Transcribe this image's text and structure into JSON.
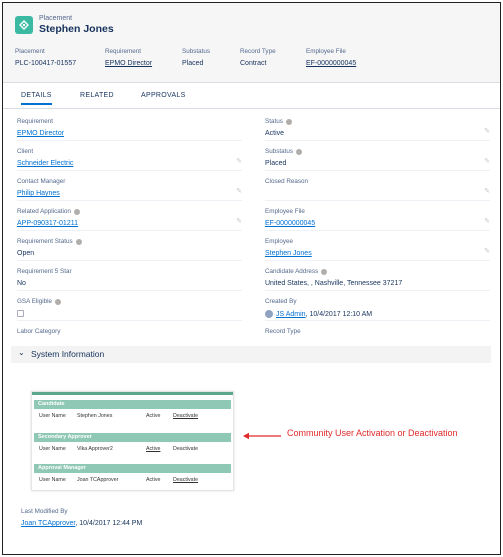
{
  "header": {
    "object_label": "Placement",
    "title": "Stephen Jones",
    "fields": [
      {
        "label": "Placement",
        "value": "PLC-100417-01557"
      },
      {
        "label": "Requirement",
        "value": "EPMO Director"
      },
      {
        "label": "Substatus",
        "value": "Placed"
      },
      {
        "label": "Record Type",
        "value": "Contract"
      },
      {
        "label": "Employee File",
        "value": "EF-0000000045"
      }
    ]
  },
  "tabs": [
    "DETAILS",
    "RELATED",
    "APPROVALS"
  ],
  "left_fields": [
    {
      "label": "Requirement",
      "value": "EPMO Director"
    },
    {
      "label": "Client",
      "value": "Schneider Electric"
    },
    {
      "label": "Contact Manager",
      "value": "Philip Haynes"
    },
    {
      "label": "Related Application",
      "value": "APP-090317-01211"
    },
    {
      "label": "Requirement Status",
      "value": "Open"
    },
    {
      "label": "Requirement 5 Star",
      "value": "No"
    },
    {
      "label": "GSA Eligible",
      "value": ""
    },
    {
      "label": "Labor Category",
      "value": ""
    }
  ],
  "right_fields": [
    {
      "label": "Status",
      "value": "Active"
    },
    {
      "label": "Substatus",
      "value": "Placed"
    },
    {
      "label": "Closed Reason",
      "value": ""
    },
    {
      "label": "Employee File",
      "value": "EF-0000000045"
    },
    {
      "label": "Employee",
      "value": "Stephen Jones"
    },
    {
      "label": "Candidate Address",
      "value": "United States, , Nashville, Tennessee 37217"
    },
    {
      "label": "Created By",
      "value_link": "JS Admin",
      "value_rest": ", 10/4/2017 12:10 AM"
    },
    {
      "label": "Record Type",
      "value": ""
    }
  ],
  "system_section": {
    "title": "System Information"
  },
  "embedded": {
    "sections": [
      {
        "title": "Candidate",
        "user_label": "User Name",
        "user": "Stephen Jones",
        "col1": "Active",
        "col2": "Deactivate"
      },
      {
        "title": "Secondary Approver",
        "user_label": "User Name",
        "user": "Vika Approver2",
        "col1": "Active",
        "col2": "Deactivate"
      },
      {
        "title": "Approval Manager",
        "user_label": "User Name",
        "user": "Joan TCApprover",
        "col1": "Active",
        "col2": "Deactivate"
      }
    ]
  },
  "annotation": "Community User Activation or Deactivation",
  "last_modified": {
    "label": "Last Modified By",
    "link": "Joan TCApprover",
    "rest": ", 10/4/2017 12:44 PM"
  },
  "colors": {
    "link": "#0070d2",
    "accent": "#3bb9a3",
    "annotation": "#e02a2a",
    "bar": "#8fc8b4"
  }
}
